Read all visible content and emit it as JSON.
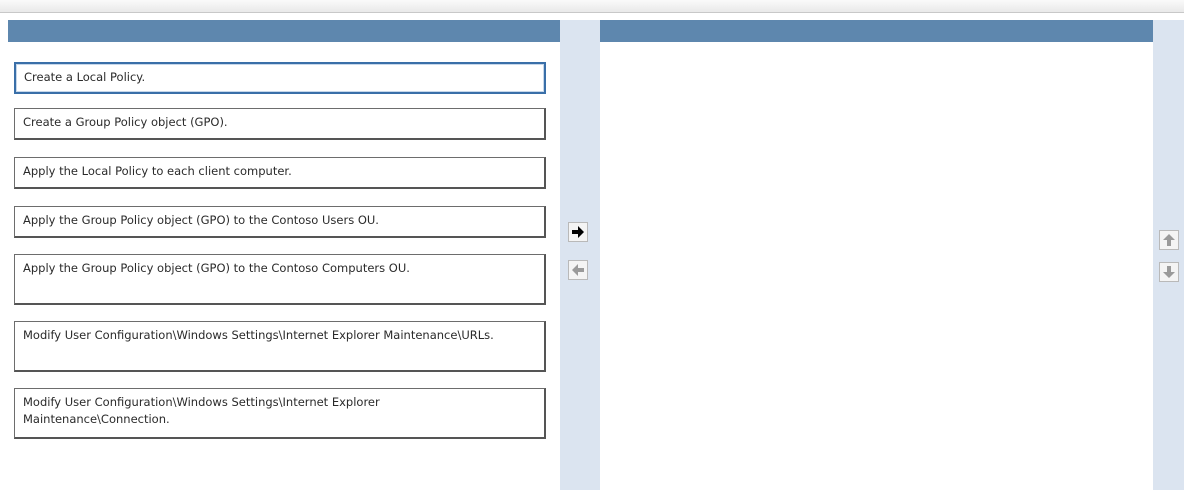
{
  "source_items": [
    "Create a Local Policy.",
    "Create a Group Policy object (GPO).",
    "Apply the Local Policy to each client computer.",
    "Apply the Group Policy object (GPO) to the Contoso Users OU.",
    "Apply the Group Policy object (GPO) to the Contoso Computers OU.",
    "Modify User Configuration\\Windows Settings\\Internet Explorer Maintenance\\URLs.",
    "Modify User Configuration\\Windows Settings\\Internet Explorer Maintenance\\Connection."
  ],
  "target_items": [],
  "controls": {
    "move_right_icon": "arrow-right-icon",
    "move_left_icon": "arrow-left-icon",
    "move_up_icon": "arrow-up-icon",
    "move_down_icon": "arrow-down-icon"
  },
  "colors": {
    "header": "#5e87ae",
    "separator": "#dbe4f0",
    "active_arrow": "#000000",
    "disabled_arrow": "#9a9a9a"
  }
}
